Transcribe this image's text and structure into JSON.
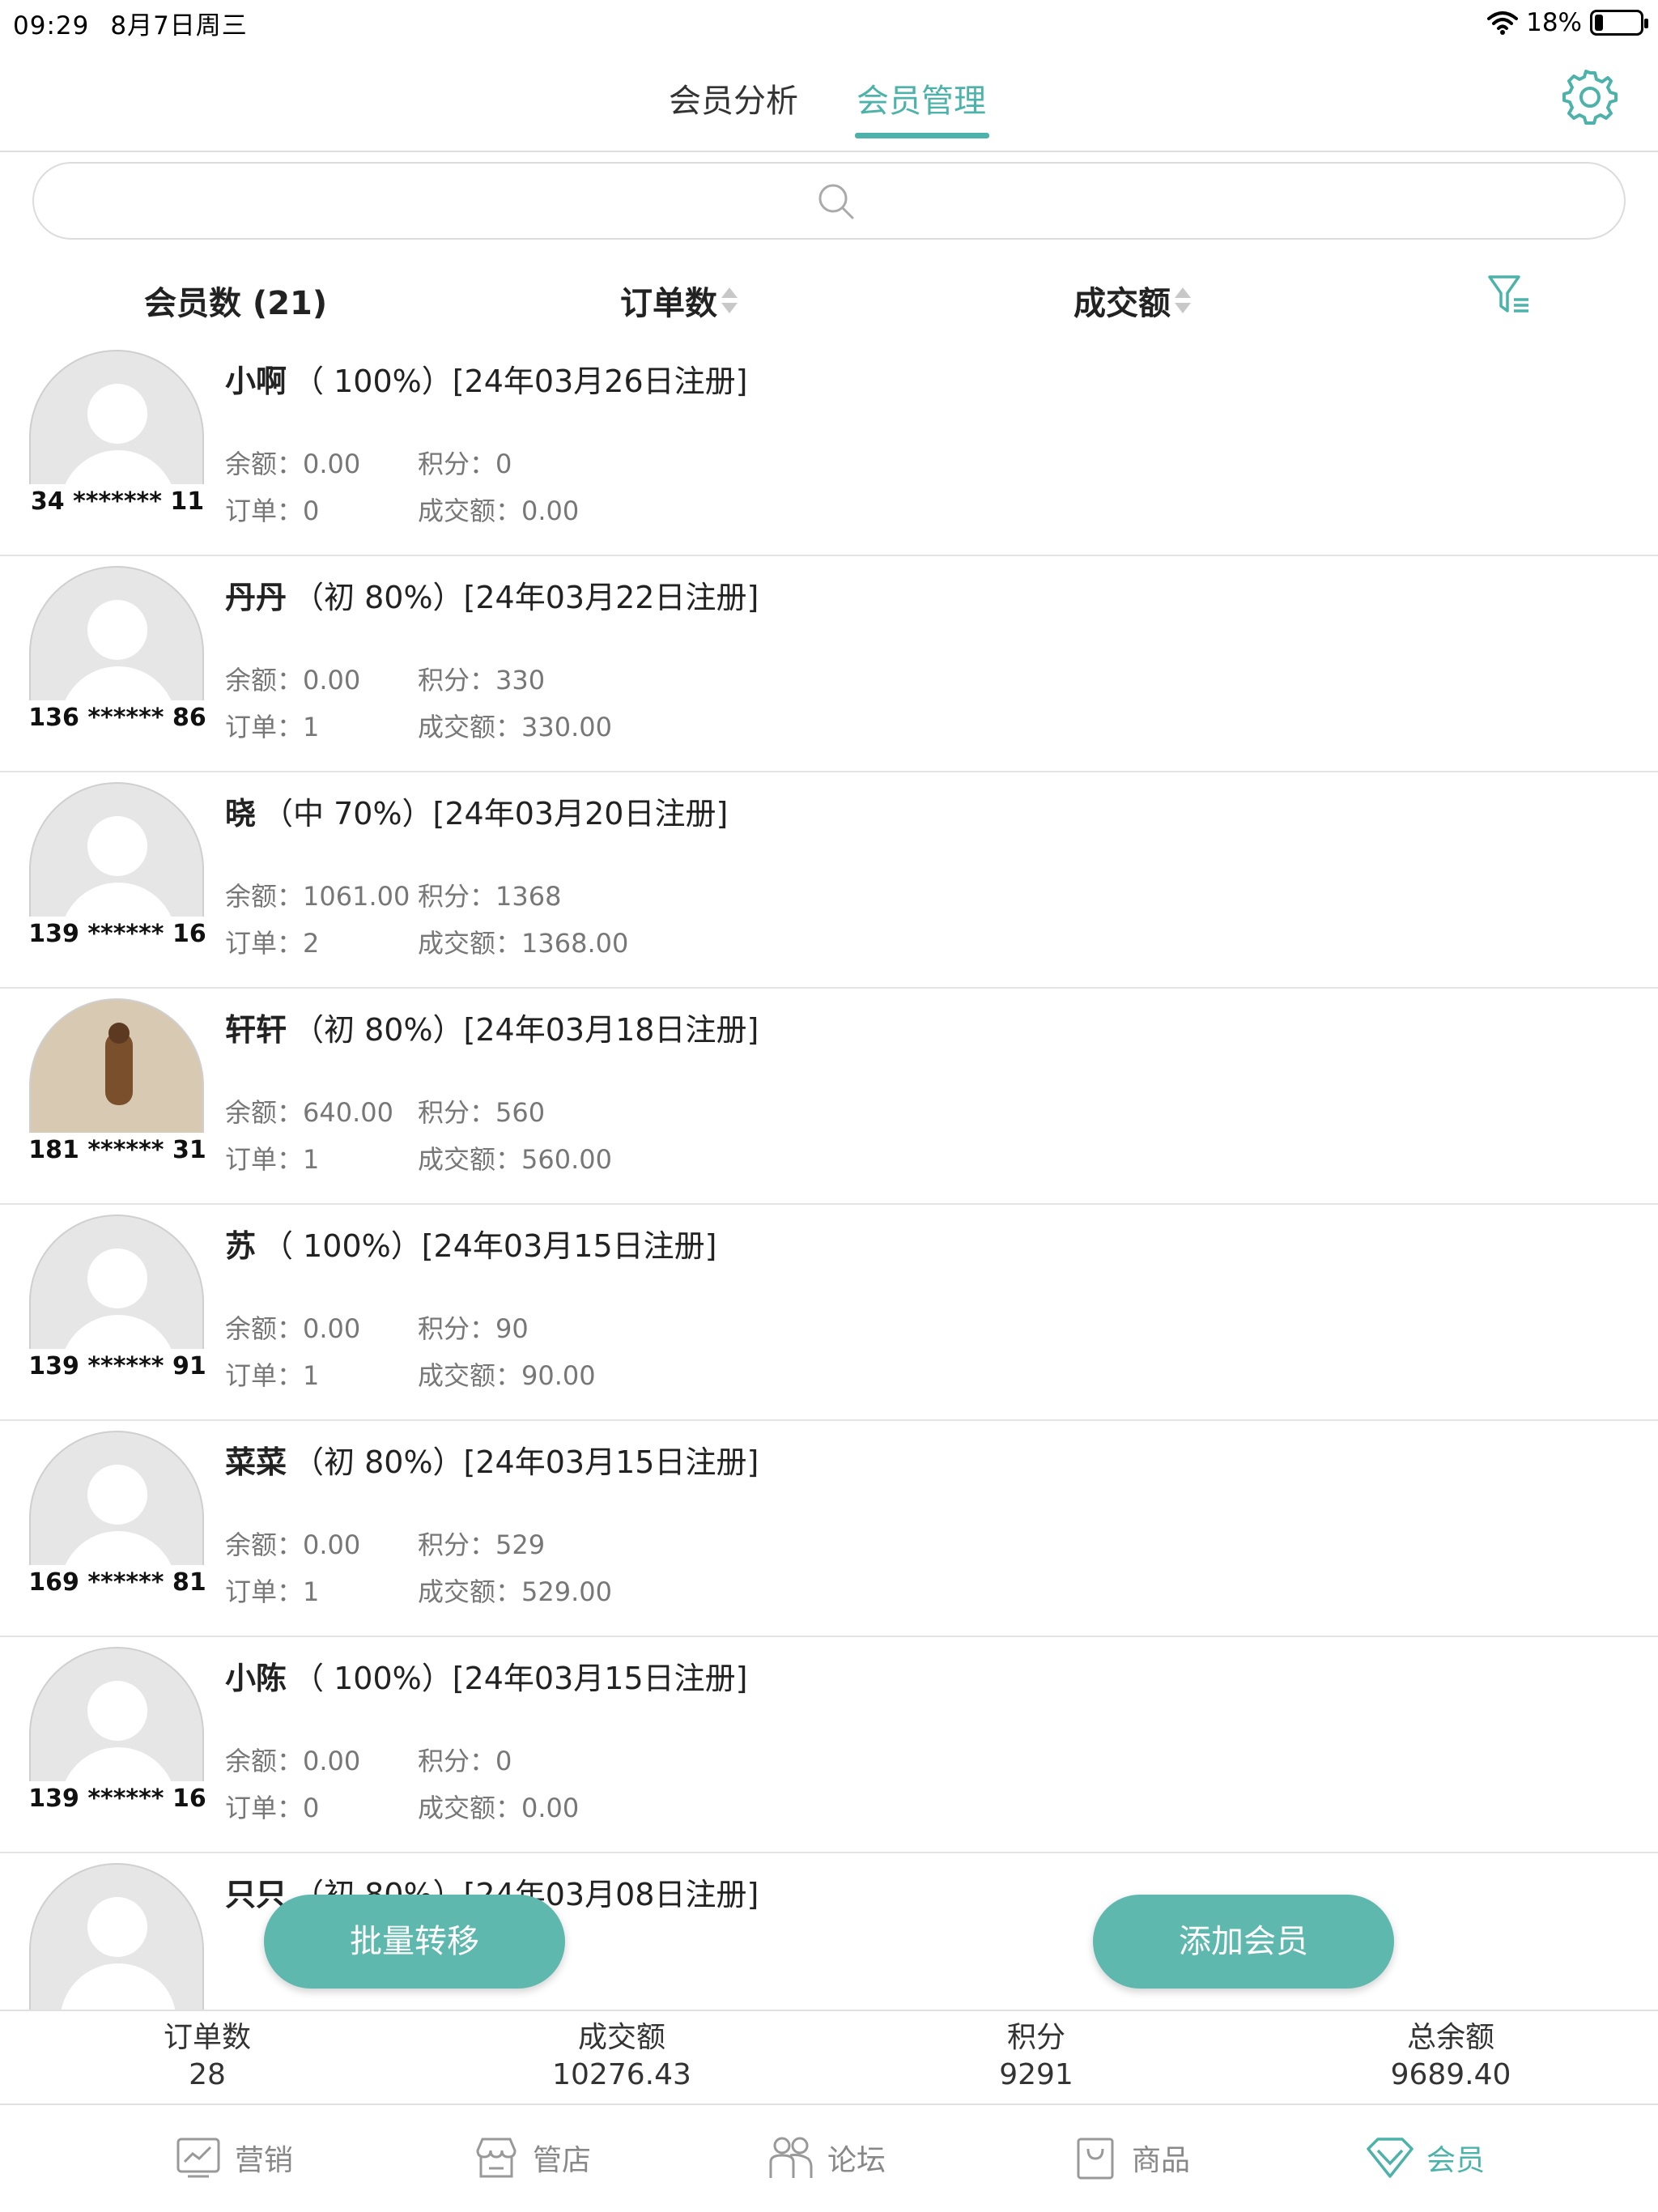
{
  "status_bar": {
    "time": "09:29",
    "date": "8月7日周三",
    "battery": "18%",
    "battery_level": 0.18
  },
  "header": {
    "tabs": [
      {
        "label": "会员分析",
        "active": false
      },
      {
        "label": "会员管理",
        "active": true
      }
    ],
    "settings_icon": "gear-icon"
  },
  "search": {
    "placeholder": "",
    "value": ""
  },
  "columns": {
    "members": "会员数 (21)",
    "orders": "订单数",
    "amount": "成交额",
    "filter_icon": "filter-icon"
  },
  "labels": {
    "balance": "余额：",
    "points": "积分：",
    "orders": "订单：",
    "amount": "成交额："
  },
  "members": [
    {
      "name": "小啊",
      "info": "（ 100%）[24年03月26日注册]",
      "phone": "34 ******* 11",
      "balance": "0.00",
      "points": "0",
      "orders": "0",
      "amount": "0.00",
      "avatar": "default"
    },
    {
      "name": "丹丹",
      "info": "（初 80%）[24年03月22日注册]",
      "phone": "136 ****** 86",
      "balance": "0.00",
      "points": "330",
      "orders": "1",
      "amount": "330.00",
      "avatar": "default"
    },
    {
      "name": "晓",
      "info": "（中 70%）[24年03月20日注册]",
      "phone": "139 ****** 16",
      "balance": "1061.00",
      "points": "1368",
      "orders": "2",
      "amount": "1368.00",
      "avatar": "default"
    },
    {
      "name": "轩轩",
      "info": "（初 80%）[24年03月18日注册]",
      "phone": "181 ****** 31",
      "balance": "640.00",
      "points": "560",
      "orders": "1",
      "amount": "560.00",
      "avatar": "photo"
    },
    {
      "name": "苏",
      "info": "（ 100%）[24年03月15日注册]",
      "phone": "139 ****** 91",
      "balance": "0.00",
      "points": "90",
      "orders": "1",
      "amount": "90.00",
      "avatar": "default"
    },
    {
      "name": "菜菜",
      "info": "（初 80%）[24年03月15日注册]",
      "phone": "169 ****** 81",
      "balance": "0.00",
      "points": "529",
      "orders": "1",
      "amount": "529.00",
      "avatar": "default"
    },
    {
      "name": "小陈",
      "info": "（ 100%）[24年03月15日注册]",
      "phone": "139 ****** 16",
      "balance": "0.00",
      "points": "0",
      "orders": "0",
      "amount": "0.00",
      "avatar": "default"
    },
    {
      "name": "只只",
      "info": "（初 80%）[24年03月08日注册]",
      "phone": "",
      "balance": "",
      "points": "",
      "orders": "",
      "amount": "",
      "avatar": "default"
    }
  ],
  "buttons": {
    "batch_transfer": "批量转移",
    "add_member": "添加会员"
  },
  "summary": [
    {
      "label": "订单数",
      "value": "28"
    },
    {
      "label": "成交额",
      "value": "10276.43"
    },
    {
      "label": "积分",
      "value": "9291"
    },
    {
      "label": "总余额",
      "value": "9689.40"
    }
  ],
  "nav": [
    {
      "label": "营销",
      "icon": "chart-icon",
      "active": false
    },
    {
      "label": "管店",
      "icon": "store-icon",
      "active": false
    },
    {
      "label": "论坛",
      "icon": "people-icon",
      "active": false
    },
    {
      "label": "商品",
      "icon": "bag-icon",
      "active": false
    },
    {
      "label": "会员",
      "icon": "diamond-icon",
      "active": true
    }
  ],
  "colors": {
    "accent": "#4db3aa",
    "button": "#5fb8ae",
    "text_muted": "#777777"
  }
}
